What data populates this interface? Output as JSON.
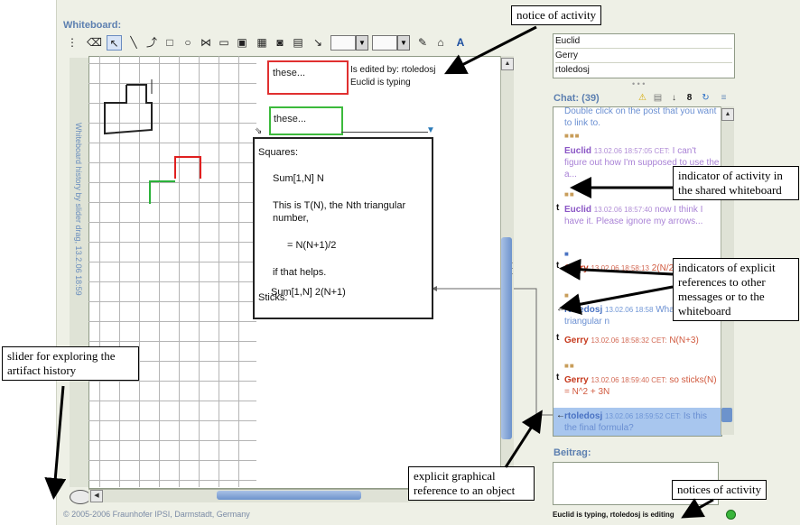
{
  "whiteboard": {
    "title": "Whiteboard:",
    "footer": "© 2005-2006 Fraunhofer IPSI, Darmstadt, Germany",
    "side_history_text": "Whiteboard history by slider drag, 13.2.06 18:59"
  },
  "postits": {
    "red_label": "these...",
    "edited_by": "Is edited by: rtoledosj",
    "typing": "Euclid is typing",
    "green_label": "these..."
  },
  "note": {
    "lines": [
      "Squares:",
      "Sum[1,N]  N",
      "This is T(N), the Nth triangular",
      "number,",
      "= N(N+1)/2",
      "if that helps.",
      "Sticks:",
      "Sum[1,N]  2(N+1)"
    ]
  },
  "users": [
    "Euclid",
    "Gerry",
    "rtoledosj"
  ],
  "chat": {
    "title": "Chat: (39)",
    "messages": [
      {
        "text": "Double click on the post that you want to link to."
      },
      {
        "user": "Euclid",
        "time": "13.02.06 18:57:05 CET:",
        "text": "I can't figure out how I'm supposed to use the a..."
      },
      {
        "user": "Euclid",
        "time": "13.02.06 18:57:40",
        "text": "now I think I have it. Please ignore my arrows..."
      },
      {
        "user": "Gerry",
        "time": "13.02.06 18:58:13",
        "text": "2(N/2)(2+N+1)"
      },
      {
        "user": "rtoledosj",
        "time": "13.02.06 18:58",
        "text": "What is this triangular n"
      },
      {
        "user": "Gerry",
        "time": "13.02.06 18:58:32 CET:",
        "text": "N(N+3)"
      },
      {
        "user": "Gerry",
        "time": "13.02.06 18:59:40 CET:",
        "text": "so sticks(N) = N^2 + 3N"
      },
      {
        "user": "rtoledosj",
        "time": "13.02.06 18:59:52 CET:",
        "text": "Is this the final formula?"
      }
    ]
  },
  "input": {
    "label": "Beitrag:",
    "status": "Euclid is typing, rtoledosj is editing"
  },
  "callouts": {
    "notice_activity": "notice of activity",
    "indicator_activity": "indicator of activity in the shared whiteboard",
    "indicators_references": "indicators of explicit references to other messages or to the whiteboard",
    "slider_history": "slider for exploring the artifact history",
    "graphical_reference": "explicit graphical reference to an object",
    "notices_activity": "notices of activity"
  }
}
